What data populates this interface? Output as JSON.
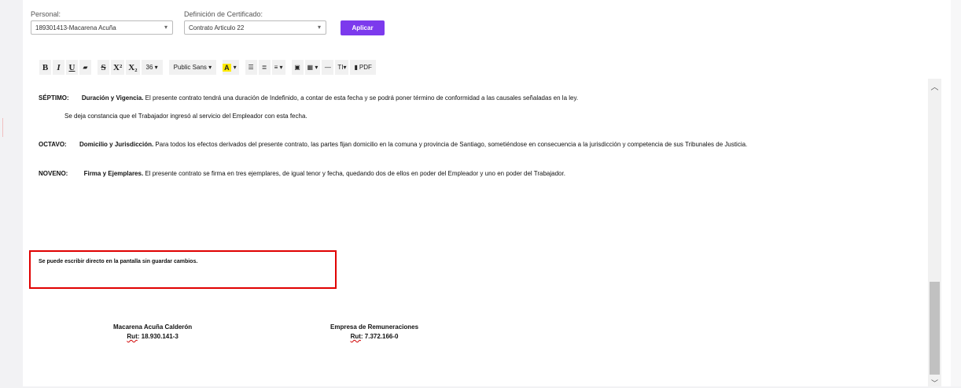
{
  "filters": {
    "personal_label": "Personal:",
    "personal_value": "189301413-Macarena Acuña",
    "cert_label": "Definición de Certificado:",
    "cert_value": "Contrato Articulo 22",
    "apply_label": "Aplicar"
  },
  "toolbar": {
    "bold": "B",
    "italic": "I",
    "underline": "U",
    "clear": "▰",
    "strike": "S",
    "sup": "X²",
    "sub": "X₂",
    "font_size": "36 ▾",
    "font_family": "Public Sans ▾",
    "highlight": "A",
    "highlight_caret": "▾",
    "ul": "☰",
    "ol": "≣",
    "align": "≡ ▾",
    "image": "▣",
    "table": "▦ ▾",
    "hr": "—",
    "text_style": "TI▾",
    "pdf": "PDF"
  },
  "contract": {
    "septimo": {
      "label": "SÉPTIMO:",
      "title": "Duración y Vigencia.",
      "text": " El presente contrato tendrá una duración de Indefinido, a contar de esta fecha y se podrá poner término de conformidad a las causales señaladas en la ley.",
      "note": "Se deja constancia que el Trabajador ingresó al servicio del Empleador con esta fecha."
    },
    "octavo": {
      "label": "OCTAVO:",
      "title": "Domicilio y Jurisdicción.",
      "text": " Para todos los efectos derivados del presente contrato, las partes fijan domicilio en la comuna y provincia de Santiago, sometiéndose en consecuencia a la jurisdicción y competencia de sus Tribunales de Justicia."
    },
    "noveno": {
      "label": "NOVENO:",
      "title": "Firma y Ejemplares.",
      "text": " El presente contrato se firma en tres ejemplares, de igual tenor y fecha, quedando dos de ellos en poder del Empleador y uno en poder del Trabajador."
    }
  },
  "hint": "Se puede escribir directo en la pantalla sin guardar cambios.",
  "signatures": {
    "left_name": "Macarena Acuña Calderón",
    "left_rut_label": "Rut",
    "left_rut": ": 18.930.141-3",
    "right_name": "Empresa de Remuneraciones",
    "right_rut_label": "Rut",
    "right_rut": ": 7.372.166-0"
  },
  "colors": {
    "accent": "#7c3aed",
    "highlight_box": "#e00000"
  }
}
